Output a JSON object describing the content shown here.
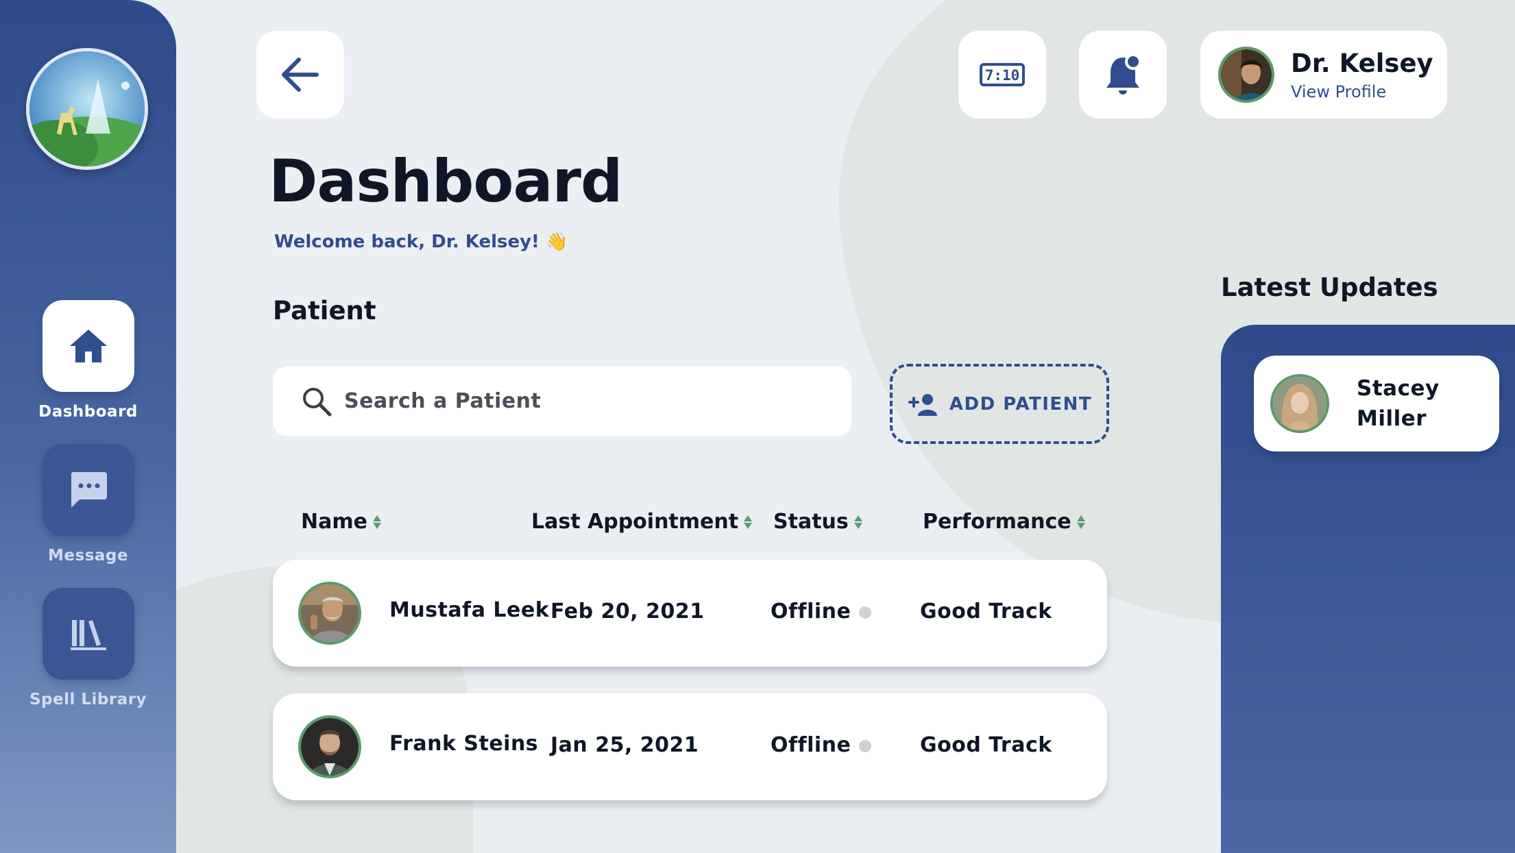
{
  "nav": {
    "items": [
      {
        "label": "Dashboard",
        "icon": "home-icon",
        "active": true
      },
      {
        "label": "Message",
        "icon": "chat-icon",
        "active": false
      },
      {
        "label": "Spell Library",
        "icon": "library-icon",
        "active": false
      }
    ]
  },
  "header": {
    "clock_text": "7:10",
    "profile": {
      "name": "Dr. Kelsey",
      "link": "View Profile"
    }
  },
  "main": {
    "title": "Dashboard",
    "welcome": "Welcome back, Dr. Kelsey! 👋",
    "section_title": "Patient",
    "search_placeholder": "Search a Patient",
    "add_button": "ADD PATIENT",
    "columns": [
      "Name",
      "Last Appointment",
      "Status",
      "Performance"
    ],
    "patients": [
      {
        "name": "Mustafa Leek",
        "last_appointment": "Feb 20, 2021",
        "status": "Offline",
        "performance": "Good Track"
      },
      {
        "name": "Frank Steins",
        "last_appointment": "Jan 25, 2021",
        "status": "Offline",
        "performance": "Good Track"
      }
    ]
  },
  "updates": {
    "title": "Latest Updates",
    "items": [
      {
        "name": "Stacey Miller"
      }
    ]
  },
  "colors": {
    "brand": "#2f4d8f",
    "background": "#ebeef2",
    "sort_arrows": "#5f9a78",
    "status_offline": "#cdd2d8"
  }
}
